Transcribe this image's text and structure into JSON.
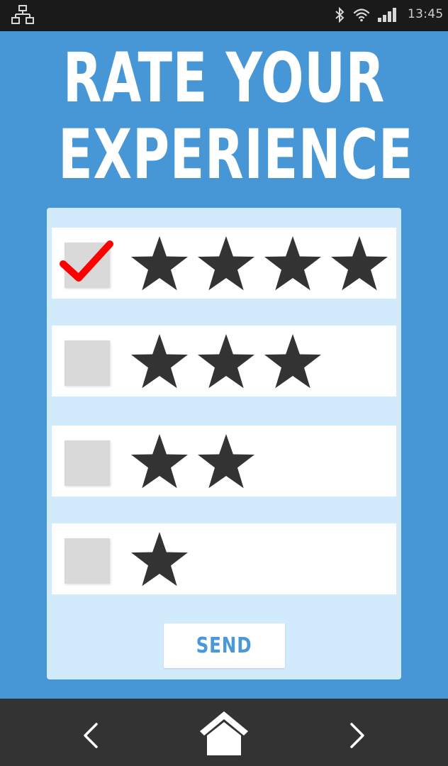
{
  "status_bar": {
    "time": "13:45",
    "icons": [
      "network-icon",
      "bluetooth-icon",
      "wifi-icon",
      "signal-icon"
    ]
  },
  "title": {
    "line1": "RATE YOUR",
    "line2": "EXPERIENCE"
  },
  "ratings": [
    {
      "stars": 4,
      "checked": true
    },
    {
      "stars": 3,
      "checked": false
    },
    {
      "stars": 2,
      "checked": false
    },
    {
      "stars": 1,
      "checked": false
    }
  ],
  "send_label": "SEND",
  "nav_bar": {
    "icons": [
      "back-icon",
      "home-icon",
      "forward-icon"
    ]
  },
  "colors": {
    "background": "#4797d7",
    "card": "#d1eafc",
    "star": "#333333",
    "checkmark": "#ff0000",
    "send_text": "#4a98d8"
  }
}
